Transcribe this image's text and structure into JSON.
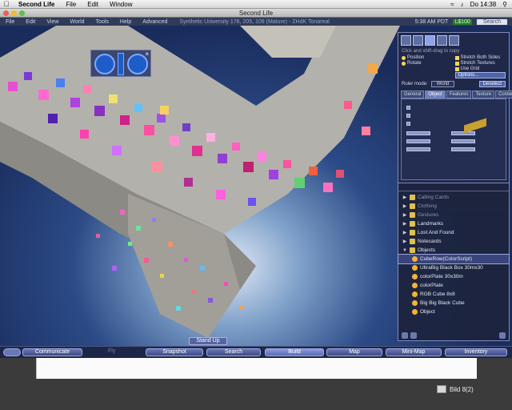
{
  "mac_menu": {
    "app": "Second Life",
    "items": [
      "File",
      "Edit",
      "Window"
    ],
    "clock": "Do 14:38"
  },
  "window": {
    "title": "Second Life"
  },
  "sl_menu": {
    "items": [
      "File",
      "Edit",
      "View",
      "World",
      "Tools",
      "Help",
      "Advanced"
    ],
    "location": "Synthetic University 176, 205, 109 (Mature) - ZHdK Tonareal",
    "time": "5:38 AM PDT",
    "balance": "L$100",
    "search": "Search"
  },
  "build_tools": {
    "hint": "Click and shift-drag to copy",
    "options": {
      "position": "Position",
      "rotate": "Rotate",
      "stretch_both": "Stretch Both Sides",
      "stretch_textures": "Stretch Textures",
      "use_grid": "Use Grid",
      "options_button": "Options..."
    },
    "ruler_label": "Ruler mode:",
    "ruler_value": "World",
    "deselect": "Deselect",
    "tabs": [
      "General",
      "Object",
      "Features",
      "Texture",
      "Content"
    ],
    "active_tab": "Object"
  },
  "inventory": {
    "items": [
      {
        "label": "Calling Cards",
        "type": "folder",
        "level": 0
      },
      {
        "label": "Clothing",
        "type": "folder",
        "level": 0
      },
      {
        "label": "Gestures",
        "type": "folder",
        "level": 0
      },
      {
        "label": "Landmarks",
        "type": "folder",
        "level": 0
      },
      {
        "label": "Lost And Found",
        "type": "folder",
        "level": 0
      },
      {
        "label": "Notecards",
        "type": "folder",
        "level": 0
      },
      {
        "label": "Objects",
        "type": "folder",
        "level": 0,
        "open": true
      },
      {
        "label": "CubeRow(ColorScript)",
        "type": "object",
        "level": 1,
        "selected": true
      },
      {
        "label": "UltraBig Black Box 30mx30",
        "type": "object",
        "level": 1
      },
      {
        "label": "colorPlate 30x30m",
        "type": "object",
        "level": 1
      },
      {
        "label": "colorPlate",
        "type": "object",
        "level": 1
      },
      {
        "label": "RGB Cube 8x8",
        "type": "object",
        "level": 1
      },
      {
        "label": "Big Big Black Cube",
        "type": "object",
        "level": 1
      },
      {
        "label": "Object",
        "type": "object",
        "level": 1
      }
    ]
  },
  "bottom_bar": {
    "stand_up": "Stand Up",
    "communicate": "Communicate",
    "fly": "Fly",
    "snapshot": "Snapshot",
    "search": "Search",
    "build": "Build",
    "map": "Map",
    "mini_map": "Mini-Map",
    "inventory": "Inventory"
  },
  "desktop": {
    "file_label": "Bild 8(2)"
  }
}
